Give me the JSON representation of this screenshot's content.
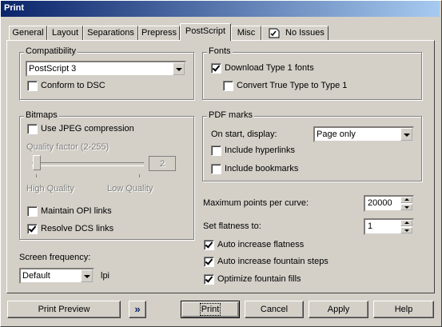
{
  "window": {
    "title": "Print"
  },
  "tabs": [
    {
      "label": "General"
    },
    {
      "label": "Layout"
    },
    {
      "label": "Separations"
    },
    {
      "label": "Prepress"
    },
    {
      "label": "PostScript"
    },
    {
      "label": "Misc"
    },
    {
      "label": "No Issues"
    }
  ],
  "compatibility": {
    "legend": "Compatibility",
    "level_value": "PostScript 3",
    "conform_dsc": {
      "label": "Conform to DSC",
      "checked": false
    }
  },
  "fonts": {
    "legend": "Fonts",
    "download_type1": {
      "label": "Download Type 1 fonts",
      "checked": true
    },
    "convert_truetype": {
      "label": "Convert True Type to Type 1",
      "checked": false
    }
  },
  "bitmaps": {
    "legend": "Bitmaps",
    "use_jpeg": {
      "label": "Use JPEG compression",
      "checked": false
    },
    "quality_label": "Quality factor (2-255)",
    "quality_value": "2",
    "high_quality": "High Quality",
    "low_quality": "Low Quality",
    "maintain_opi": {
      "label": "Maintain OPI links",
      "checked": false
    },
    "resolve_dcs": {
      "label": "Resolve DCS links",
      "checked": true
    }
  },
  "pdf_marks": {
    "legend": "PDF marks",
    "on_start_label": "On start, display:",
    "on_start_value": "Page only",
    "include_hyperlinks": {
      "label": "Include hyperlinks",
      "checked": false
    },
    "include_bookmarks": {
      "label": "Include bookmarks",
      "checked": false
    }
  },
  "curves": {
    "max_points_label": "Maximum points per curve:",
    "max_points_value": "20000",
    "flatness_label": "Set flatness to:",
    "flatness_value": "1",
    "auto_flatness": {
      "label": "Auto increase flatness",
      "checked": true
    },
    "auto_fountain": {
      "label": "Auto increase fountain steps",
      "checked": true
    },
    "optimize_fountain": {
      "label": "Optimize fountain fills",
      "checked": true
    }
  },
  "screen": {
    "label": "Screen frequency:",
    "value": "Default",
    "unit": "lpi"
  },
  "buttons": {
    "print_preview": "Print Preview",
    "expand": "»",
    "print": "Print",
    "cancel": "Cancel",
    "apply": "Apply",
    "help": "Help"
  }
}
